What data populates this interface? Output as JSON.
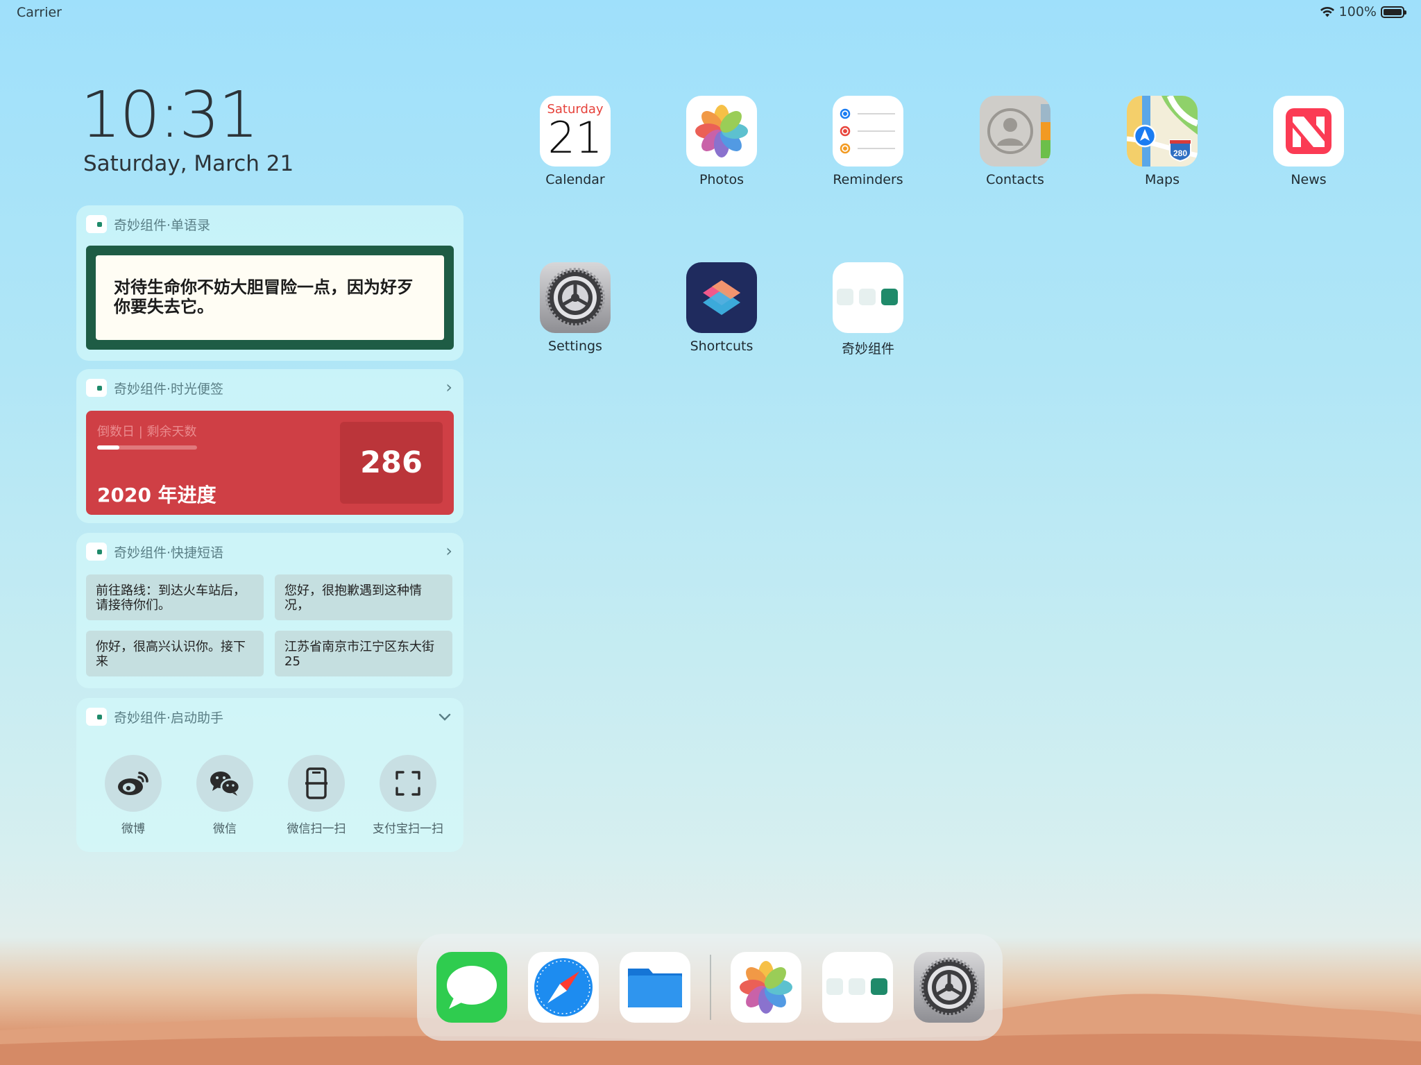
{
  "status_bar": {
    "carrier": "Carrier",
    "battery_text": "100%"
  },
  "lock": {
    "time": "10:31",
    "date": "Saturday, March 21"
  },
  "widgets": {
    "quote": {
      "header": "奇妙组件·单语录",
      "text": "对待生命你不妨大胆冒险一点，因为好歹你要失去它。"
    },
    "countdown": {
      "header": "奇妙组件·时光便签",
      "label": "倒数日 | 剩余天数",
      "title": "2020 年进度",
      "days": "286",
      "progress_fraction": 0.22
    },
    "phrases": {
      "header": "奇妙组件·快捷短语",
      "items": [
        "前往路线：到达火车站后，请接待你们。",
        "您好，很抱歉遇到这种情况，",
        "你好，很高兴认识你。接下来",
        "江苏省南京市江宁区东大街 25"
      ]
    },
    "launcher": {
      "header": "奇妙组件·启动助手",
      "items": [
        {
          "label": "微博",
          "icon": "weibo-icon"
        },
        {
          "label": "微信",
          "icon": "wechat-icon"
        },
        {
          "label": "微信扫一扫",
          "icon": "scan-phone-icon"
        },
        {
          "label": "支付宝扫一扫",
          "icon": "scan-frame-icon"
        }
      ]
    }
  },
  "apps": [
    {
      "label": "Calendar",
      "icon": "calendar-icon",
      "cal_day": "Saturday",
      "cal_date": "21"
    },
    {
      "label": "Photos",
      "icon": "photos-icon"
    },
    {
      "label": "Reminders",
      "icon": "reminders-icon"
    },
    {
      "label": "Contacts",
      "icon": "contacts-icon"
    },
    {
      "label": "Maps",
      "icon": "maps-icon",
      "badge": "280"
    },
    {
      "label": "News",
      "icon": "news-icon"
    },
    {
      "label": "Settings",
      "icon": "settings-icon"
    },
    {
      "label": "Shortcuts",
      "icon": "shortcuts-icon"
    },
    {
      "label": "奇妙组件",
      "icon": "widget-app-icon"
    }
  ],
  "dock": [
    {
      "icon": "messages-icon"
    },
    {
      "icon": "safari-icon"
    },
    {
      "icon": "files-icon"
    },
    {
      "icon": "photos-icon"
    },
    {
      "icon": "widget-app-icon"
    },
    {
      "icon": "settings-icon"
    }
  ],
  "colors": {
    "quote_frame": "#1e5c45",
    "countdown_red": "#cf3f45",
    "widget_green": "#1f8a6a",
    "calendar_red": "#e6423b"
  }
}
